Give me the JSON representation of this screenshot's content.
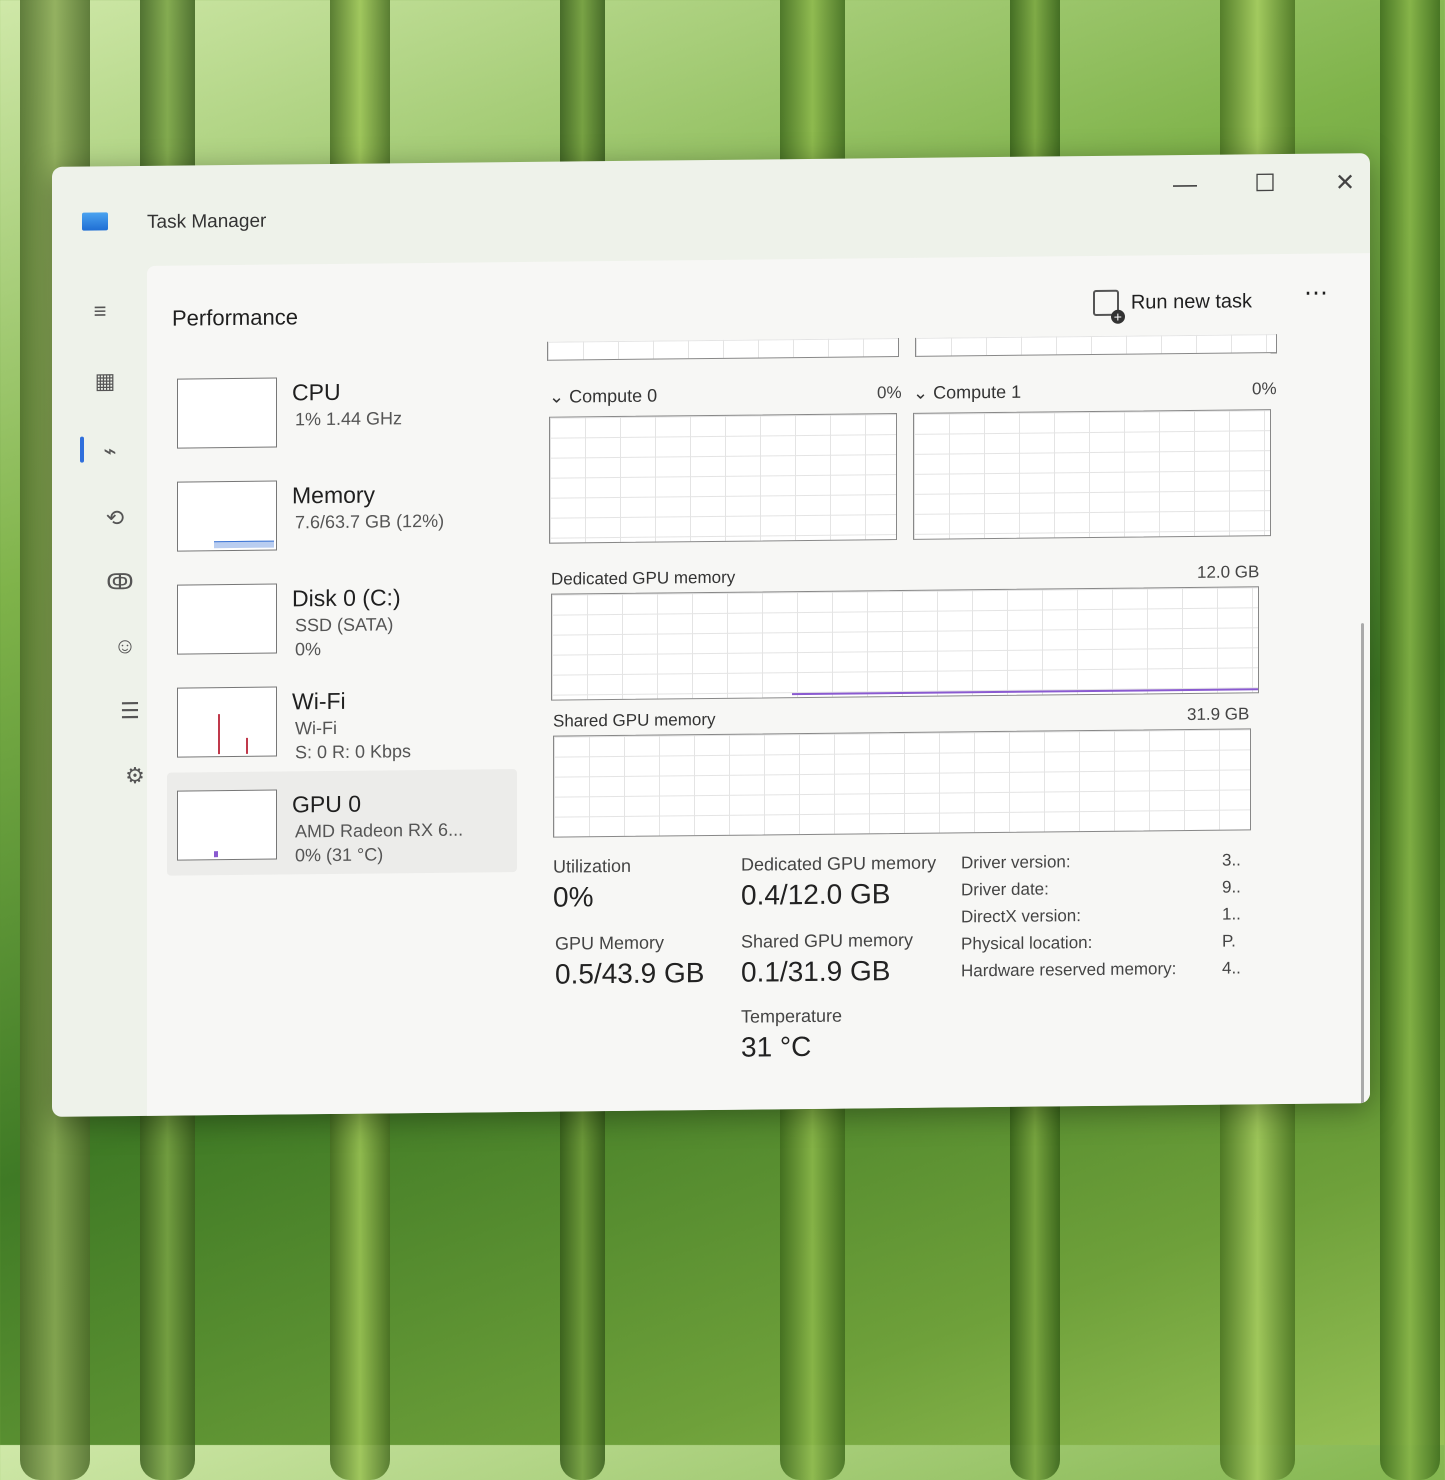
{
  "window": {
    "title": "Task Manager"
  },
  "header": {
    "page_title": "Performance",
    "run_new_task": "Run new task",
    "more": "⋯"
  },
  "devices": [
    {
      "name": "CPU",
      "sub1": "1% 1.44 GHz",
      "sub2": ""
    },
    {
      "name": "Memory",
      "sub1": "7.6/63.7 GB (12%)",
      "sub2": ""
    },
    {
      "name": "Disk 0 (C:)",
      "sub1": "SSD (SATA)",
      "sub2": "0%"
    },
    {
      "name": "Wi-Fi",
      "sub1": "Wi-Fi",
      "sub2": "S: 0 R: 0 Kbps"
    },
    {
      "name": "GPU 0",
      "sub1": "AMD Radeon RX 6...",
      "sub2": "0% (31 °C)"
    }
  ],
  "gpu": {
    "compute0": {
      "label": "Compute 0",
      "value": "0%"
    },
    "compute1": {
      "label": "Compute 1",
      "value": "0%"
    },
    "dedicated_graph": {
      "label": "Dedicated GPU memory",
      "max": "12.0 GB"
    },
    "shared_graph": {
      "label": "Shared GPU memory",
      "max": "31.9 GB"
    },
    "stats": {
      "utilization_label": "Utilization",
      "utilization": "0%",
      "dedicated_label": "Dedicated GPU memory",
      "dedicated": "0.4/12.0 GB",
      "gpu_memory_label": "GPU Memory",
      "gpu_memory": "0.5/43.9 GB",
      "shared_label": "Shared GPU memory",
      "shared": "0.1/31.9 GB",
      "temperature_label": "Temperature",
      "temperature": "31 °C"
    },
    "info": [
      {
        "key": "Driver version:",
        "value": "3.."
      },
      {
        "key": "Driver date:",
        "value": "9.."
      },
      {
        "key": "DirectX version:",
        "value": "1.."
      },
      {
        "key": "Physical location:",
        "value": "P."
      },
      {
        "key": "Hardware reserved memory:",
        "value": "4.."
      }
    ]
  },
  "icons": {
    "hamburger": "≡",
    "processes": "▦",
    "performance": "⌁",
    "history": "⟲",
    "startup": "ↂ",
    "users": "☺",
    "details": "☰",
    "services": "⚙",
    "settings": "⚙"
  }
}
